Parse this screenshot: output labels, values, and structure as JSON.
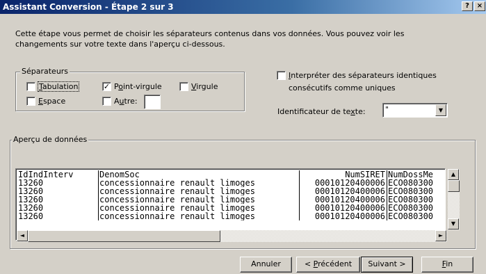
{
  "window": {
    "title": "Assistant Conversion - Étape 2 sur 3",
    "help": "?",
    "close": "×"
  },
  "description": "Cette étape vous permet de choisir les séparateurs contenus dans vos données. Vous pouvez voir les changements sur votre texte dans l'aperçu ci-dessous.",
  "separators": {
    "legend": "Séparateurs",
    "tab": {
      "label_pre": "",
      "label_u": "T",
      "label_post": "abulation",
      "checked": false
    },
    "semicolon": {
      "label_pre": "P",
      "label_u": "o",
      "label_post": "int-virgule",
      "checked": true
    },
    "comma": {
      "label_pre": "",
      "label_u": "V",
      "label_post": "irgule",
      "checked": false
    },
    "space": {
      "label_pre": "",
      "label_u": "E",
      "label_post": "space",
      "checked": false
    },
    "other": {
      "label_pre": "A",
      "label_u": "u",
      "label_post": "tre:",
      "checked": false,
      "value": ""
    }
  },
  "consecutive": {
    "line1_u": "I",
    "line1_post": "nterpréter des séparateurs identiques",
    "line2": "consécutifs comme uniques",
    "checked": false
  },
  "text_qualifier": {
    "label_pre": "Identificateur de te",
    "label_u": "x",
    "label_post": "te:",
    "value": "\""
  },
  "preview": {
    "legend": "Aperçu de données",
    "headers": [
      "IdIndInterv",
      "DenomSoc",
      "NumSIRET",
      "NumDossMe"
    ],
    "rows": [
      [
        "13260",
        "concessionnaire renault limoges",
        "00010120400006",
        "ECO080300"
      ],
      [
        "13260",
        "concessionnaire renault limoges",
        "00010120400006",
        "ECO080300"
      ],
      [
        "13260",
        "concessionnaire renault limoges",
        "00010120400006",
        "ECO080300"
      ],
      [
        "13260",
        "concessionnaire renault limoges",
        "00010120400006",
        "ECO080300"
      ],
      [
        "13260",
        "concessionnaire renault limoges",
        "00010120400006",
        "ECO080300"
      ]
    ]
  },
  "buttons": {
    "cancel": "Annuler",
    "prev_pre": "< ",
    "prev_u": "P",
    "prev_post": "récédent",
    "next": "Suivant >",
    "finish_u": "F",
    "finish_post": "in"
  },
  "icons": {
    "up": "▲",
    "down": "▼",
    "left": "◄",
    "right": "►",
    "check": "✓"
  }
}
